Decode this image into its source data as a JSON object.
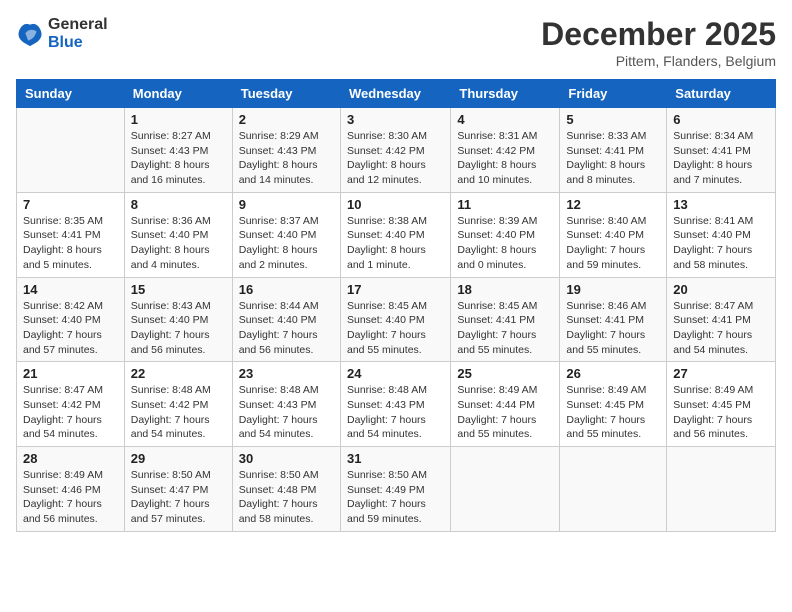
{
  "header": {
    "logo_general": "General",
    "logo_blue": "Blue",
    "title": "December 2025",
    "subtitle": "Pittem, Flanders, Belgium"
  },
  "days_of_week": [
    "Sunday",
    "Monday",
    "Tuesday",
    "Wednesday",
    "Thursday",
    "Friday",
    "Saturday"
  ],
  "weeks": [
    [
      {
        "day": "",
        "info": ""
      },
      {
        "day": "1",
        "info": "Sunrise: 8:27 AM\nSunset: 4:43 PM\nDaylight: 8 hours\nand 16 minutes."
      },
      {
        "day": "2",
        "info": "Sunrise: 8:29 AM\nSunset: 4:43 PM\nDaylight: 8 hours\nand 14 minutes."
      },
      {
        "day": "3",
        "info": "Sunrise: 8:30 AM\nSunset: 4:42 PM\nDaylight: 8 hours\nand 12 minutes."
      },
      {
        "day": "4",
        "info": "Sunrise: 8:31 AM\nSunset: 4:42 PM\nDaylight: 8 hours\nand 10 minutes."
      },
      {
        "day": "5",
        "info": "Sunrise: 8:33 AM\nSunset: 4:41 PM\nDaylight: 8 hours\nand 8 minutes."
      },
      {
        "day": "6",
        "info": "Sunrise: 8:34 AM\nSunset: 4:41 PM\nDaylight: 8 hours\nand 7 minutes."
      }
    ],
    [
      {
        "day": "7",
        "info": "Sunrise: 8:35 AM\nSunset: 4:41 PM\nDaylight: 8 hours\nand 5 minutes."
      },
      {
        "day": "8",
        "info": "Sunrise: 8:36 AM\nSunset: 4:40 PM\nDaylight: 8 hours\nand 4 minutes."
      },
      {
        "day": "9",
        "info": "Sunrise: 8:37 AM\nSunset: 4:40 PM\nDaylight: 8 hours\nand 2 minutes."
      },
      {
        "day": "10",
        "info": "Sunrise: 8:38 AM\nSunset: 4:40 PM\nDaylight: 8 hours\nand 1 minute."
      },
      {
        "day": "11",
        "info": "Sunrise: 8:39 AM\nSunset: 4:40 PM\nDaylight: 8 hours\nand 0 minutes."
      },
      {
        "day": "12",
        "info": "Sunrise: 8:40 AM\nSunset: 4:40 PM\nDaylight: 7 hours\nand 59 minutes."
      },
      {
        "day": "13",
        "info": "Sunrise: 8:41 AM\nSunset: 4:40 PM\nDaylight: 7 hours\nand 58 minutes."
      }
    ],
    [
      {
        "day": "14",
        "info": "Sunrise: 8:42 AM\nSunset: 4:40 PM\nDaylight: 7 hours\nand 57 minutes."
      },
      {
        "day": "15",
        "info": "Sunrise: 8:43 AM\nSunset: 4:40 PM\nDaylight: 7 hours\nand 56 minutes."
      },
      {
        "day": "16",
        "info": "Sunrise: 8:44 AM\nSunset: 4:40 PM\nDaylight: 7 hours\nand 56 minutes."
      },
      {
        "day": "17",
        "info": "Sunrise: 8:45 AM\nSunset: 4:40 PM\nDaylight: 7 hours\nand 55 minutes."
      },
      {
        "day": "18",
        "info": "Sunrise: 8:45 AM\nSunset: 4:41 PM\nDaylight: 7 hours\nand 55 minutes."
      },
      {
        "day": "19",
        "info": "Sunrise: 8:46 AM\nSunset: 4:41 PM\nDaylight: 7 hours\nand 55 minutes."
      },
      {
        "day": "20",
        "info": "Sunrise: 8:47 AM\nSunset: 4:41 PM\nDaylight: 7 hours\nand 54 minutes."
      }
    ],
    [
      {
        "day": "21",
        "info": "Sunrise: 8:47 AM\nSunset: 4:42 PM\nDaylight: 7 hours\nand 54 minutes."
      },
      {
        "day": "22",
        "info": "Sunrise: 8:48 AM\nSunset: 4:42 PM\nDaylight: 7 hours\nand 54 minutes."
      },
      {
        "day": "23",
        "info": "Sunrise: 8:48 AM\nSunset: 4:43 PM\nDaylight: 7 hours\nand 54 minutes."
      },
      {
        "day": "24",
        "info": "Sunrise: 8:48 AM\nSunset: 4:43 PM\nDaylight: 7 hours\nand 54 minutes."
      },
      {
        "day": "25",
        "info": "Sunrise: 8:49 AM\nSunset: 4:44 PM\nDaylight: 7 hours\nand 55 minutes."
      },
      {
        "day": "26",
        "info": "Sunrise: 8:49 AM\nSunset: 4:45 PM\nDaylight: 7 hours\nand 55 minutes."
      },
      {
        "day": "27",
        "info": "Sunrise: 8:49 AM\nSunset: 4:45 PM\nDaylight: 7 hours\nand 56 minutes."
      }
    ],
    [
      {
        "day": "28",
        "info": "Sunrise: 8:49 AM\nSunset: 4:46 PM\nDaylight: 7 hours\nand 56 minutes."
      },
      {
        "day": "29",
        "info": "Sunrise: 8:50 AM\nSunset: 4:47 PM\nDaylight: 7 hours\nand 57 minutes."
      },
      {
        "day": "30",
        "info": "Sunrise: 8:50 AM\nSunset: 4:48 PM\nDaylight: 7 hours\nand 58 minutes."
      },
      {
        "day": "31",
        "info": "Sunrise: 8:50 AM\nSunset: 4:49 PM\nDaylight: 7 hours\nand 59 minutes."
      },
      {
        "day": "",
        "info": ""
      },
      {
        "day": "",
        "info": ""
      },
      {
        "day": "",
        "info": ""
      }
    ]
  ]
}
